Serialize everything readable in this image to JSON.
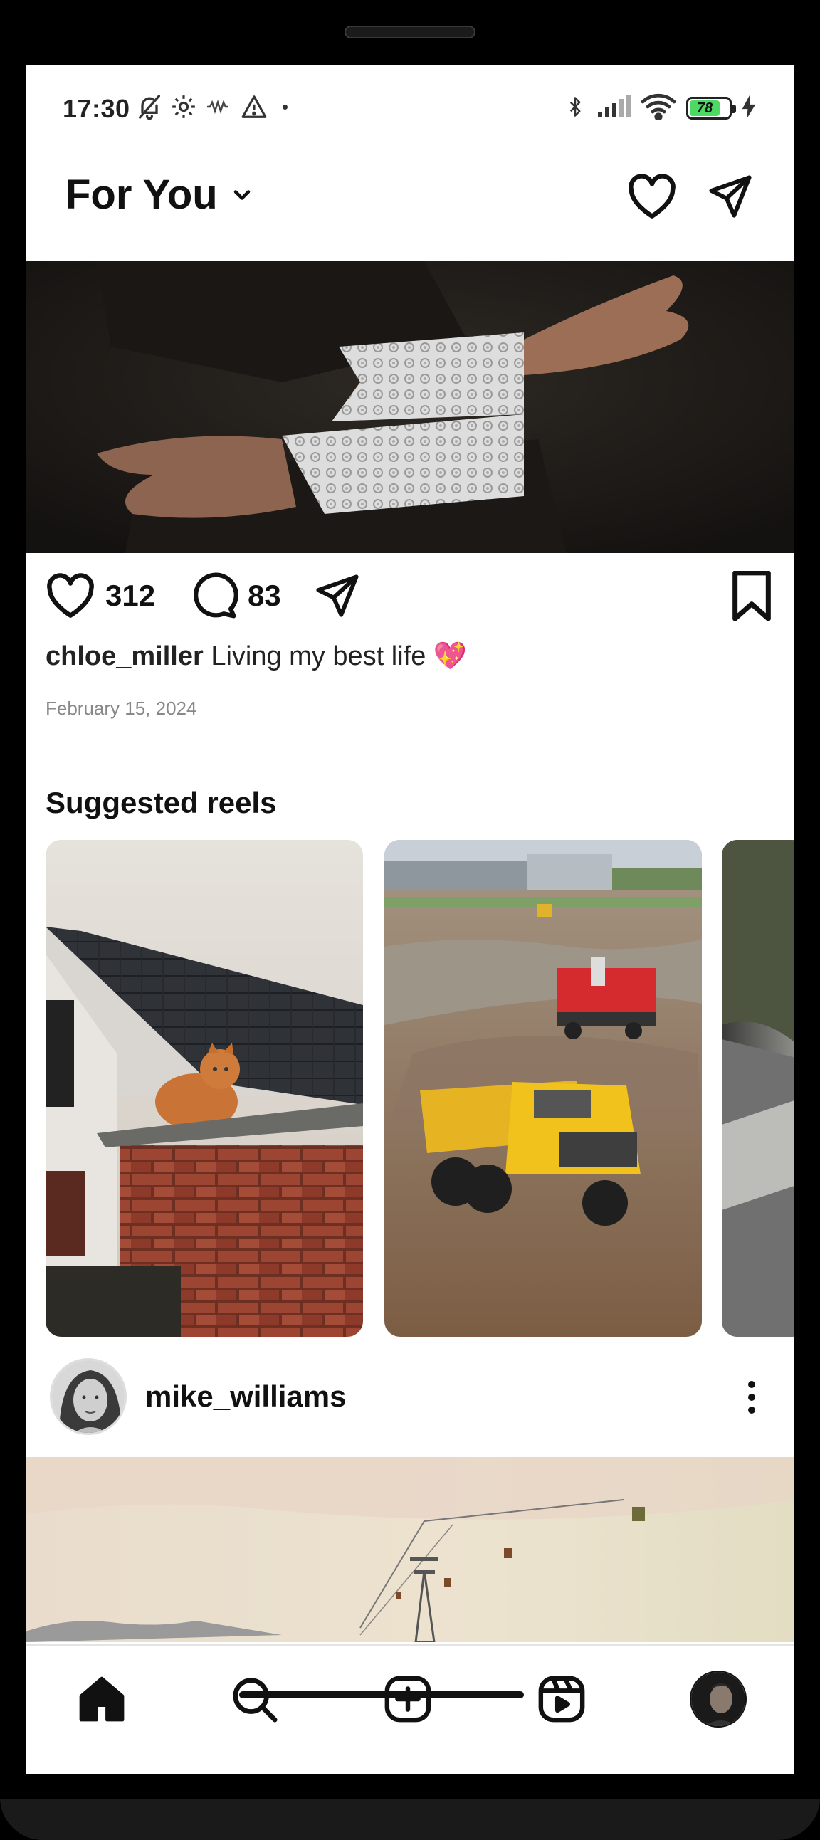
{
  "status_bar": {
    "time": "17:30",
    "battery": "78",
    "icons": [
      "bell-muted-icon",
      "settings-icon",
      "vibrate-icon",
      "warning-icon",
      "dot-icon",
      "bluetooth-icon",
      "signal-icon",
      "wifi-icon",
      "battery-icon",
      "charging-icon"
    ]
  },
  "header": {
    "title": "For You",
    "icons": [
      "chevron-down-icon",
      "heart-icon",
      "send-icon"
    ]
  },
  "post": {
    "likes": "312",
    "comments": "83",
    "username": "chloe_miller",
    "caption": "Living my best life 💖",
    "date": "February 15, 2024"
  },
  "suggested": {
    "title": "Suggested reels"
  },
  "next_post": {
    "username": "mike_williams"
  },
  "nav": {
    "icons": [
      "home-icon",
      "search-icon",
      "add-post-icon",
      "reels-icon",
      "profile-avatar"
    ]
  },
  "colors": {
    "battery_fill": "#4cd964",
    "text": "#111111",
    "muted": "#888888"
  }
}
